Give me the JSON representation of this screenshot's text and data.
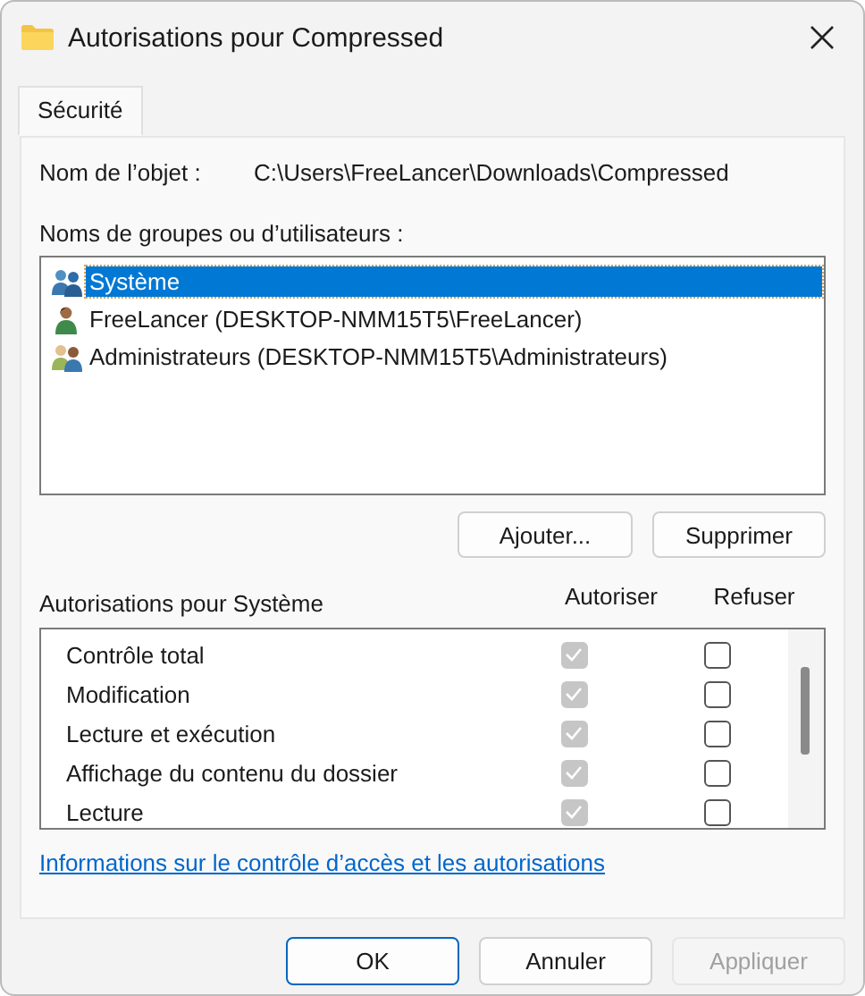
{
  "window": {
    "title": "Autorisations pour Compressed"
  },
  "tabs": [
    {
      "label": "Sécurité",
      "selected": true
    }
  ],
  "object_name": {
    "label": "Nom de l’objet :",
    "value": "C:\\Users\\FreeLancer\\Downloads\\Compressed"
  },
  "users": {
    "label": "Noms de groupes ou d’utilisateurs :",
    "items": [
      {
        "name": "Système",
        "kind": "group",
        "selected": true
      },
      {
        "name": "FreeLancer (DESKTOP-NMM15T5\\FreeLancer)",
        "kind": "user",
        "selected": false
      },
      {
        "name": "Administrateurs (DESKTOP-NMM15T5\\Administrateurs)",
        "kind": "admins",
        "selected": false
      }
    ],
    "buttons": [
      {
        "label": "Ajouter..."
      },
      {
        "label": "Supprimer"
      }
    ]
  },
  "permissions": {
    "label": "Autorisations pour Système",
    "allow_header": "Autoriser",
    "deny_header": "Refuser",
    "rows": [
      {
        "name": "Contrôle total",
        "allow": true,
        "allow_disabled": true,
        "deny": false
      },
      {
        "name": "Modification",
        "allow": true,
        "allow_disabled": true,
        "deny": false
      },
      {
        "name": "Lecture et exécution",
        "allow": true,
        "allow_disabled": true,
        "deny": false
      },
      {
        "name": "Affichage du contenu du dossier",
        "allow": true,
        "allow_disabled": true,
        "deny": false
      },
      {
        "name": "Lecture",
        "allow": true,
        "allow_disabled": true,
        "deny": false
      }
    ]
  },
  "link": "Informations sur le contrôle d’accès et les autorisations",
  "footer_buttons": [
    {
      "label": "OK",
      "default": true,
      "disabled": false
    },
    {
      "label": "Annuler",
      "default": false,
      "disabled": false
    },
    {
      "label": "Appliquer",
      "default": false,
      "disabled": true
    }
  ]
}
